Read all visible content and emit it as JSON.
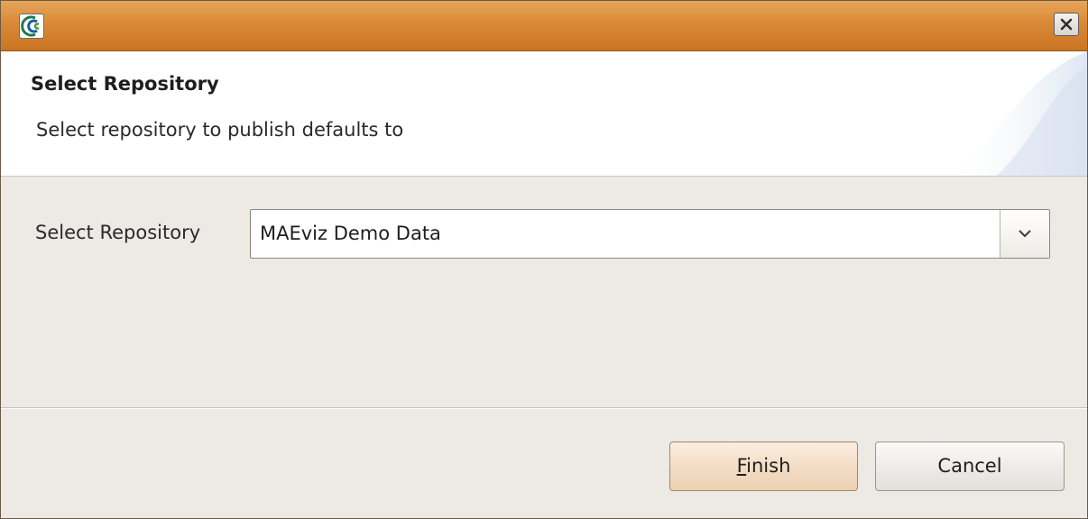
{
  "window": {
    "title": "",
    "icons": {
      "app": "app-logo-icon",
      "close": "close-icon"
    }
  },
  "header": {
    "title": "Select Repository",
    "description": "Select repository to publish defaults to"
  },
  "form": {
    "repository_label": "Select Repository",
    "repository_value": "MAEviz Demo Data",
    "dropdown_icon": "chevron-down-icon"
  },
  "buttons": {
    "finish_mnemonic": "F",
    "finish_rest": "inish",
    "cancel": "Cancel"
  },
  "colors": {
    "titlebar": "#d98a37",
    "dialog_bg": "#edeae5",
    "finish_bg": "#f3dcc4"
  }
}
